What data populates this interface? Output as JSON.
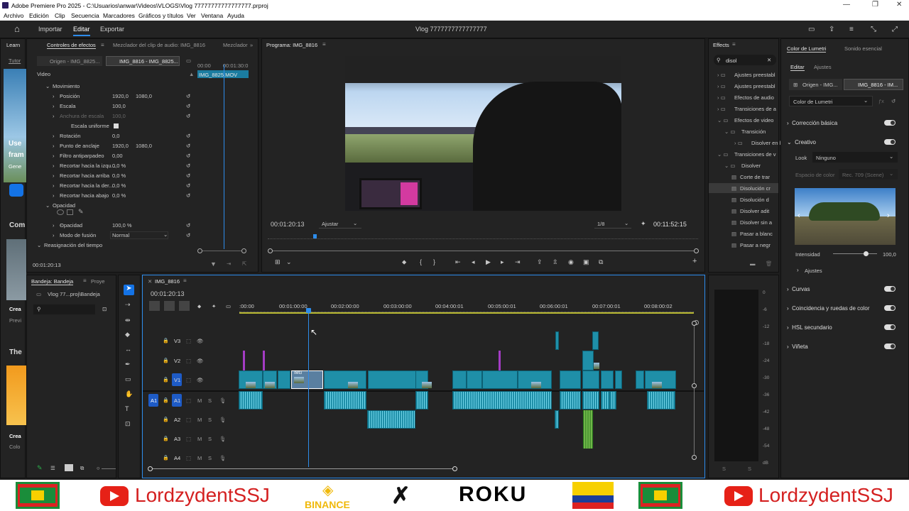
{
  "window": {
    "title": "Adobe Premiere Pro 2025 - C:\\Usuarios\\anwar\\Videos\\VLOGS\\Vlog 77777777777777777.prproj",
    "minimize": "—",
    "maximize": "❐",
    "close": "✕"
  },
  "menu": [
    "Archivo",
    "Edición",
    "Clip",
    "Secuencia",
    "Marcadores",
    "Gráficos y títulos",
    "Ver",
    "Ventana",
    "Ayuda"
  ],
  "topnav": {
    "home": "⌂",
    "import": "Importar",
    "edit": "Editar",
    "export": "Exportar",
    "project_title": "Vlog 7777777777777777"
  },
  "learn": {
    "tab": "Learn",
    "tutor": "Tutor",
    "use": "Use",
    "fram": "fram",
    "gene": "Gene",
    "com": "Com",
    "crea": "Crea",
    "previ": "Previ",
    "the": "The",
    "crea2": "Crea",
    "colo": "Colo"
  },
  "effect_controls": {
    "tabs": [
      "Controles de efectos",
      "Mezclador del clip de audio: IMG_8816",
      "Mezclador"
    ],
    "source_tab": "Origen - IMG_8825...",
    "seq_tab": "IMG_8816 - IMG_8825...",
    "ruler": [
      "00:00",
      "00:01:30:0"
    ],
    "clip_name": "IMG_8825.MOV",
    "video_label": "Video",
    "rows": [
      {
        "name": "Movimiento",
        "v1": "",
        "v2": ""
      },
      {
        "name": "Posición",
        "v1": "1920,0",
        "v2": "1080,0"
      },
      {
        "name": "Escala",
        "v1": "100,0",
        "v2": ""
      },
      {
        "name": "Anchura de escala",
        "v1": "100,0",
        "v2": ""
      },
      {
        "name": "Escala uniforme",
        "v1": "",
        "v2": ""
      },
      {
        "name": "Rotación",
        "v1": "0,0",
        "v2": ""
      },
      {
        "name": "Punto de anclaje",
        "v1": "1920,0",
        "v2": "1080,0"
      },
      {
        "name": "Filtro antiparpadeo",
        "v1": "0,00",
        "v2": ""
      },
      {
        "name": "Recortar hacia la izqu...",
        "v1": "0,0 %",
        "v2": ""
      },
      {
        "name": "Recortar hacia arriba",
        "v1": "0,0 %",
        "v2": ""
      },
      {
        "name": "Recortar hacia la der...",
        "v1": "0,0 %",
        "v2": ""
      },
      {
        "name": "Recortar hacia abajo",
        "v1": "0,0 %",
        "v2": ""
      },
      {
        "name": "Opacidad",
        "v1": "",
        "v2": ""
      },
      {
        "name": "Opacidad",
        "v1": "100,0 %",
        "v2": ""
      },
      {
        "name": "Modo de fusión",
        "v1": "Normal",
        "v2": ""
      },
      {
        "name": "Reasignación del tiempo",
        "v1": "",
        "v2": ""
      }
    ],
    "timecode": "00:01:20:13"
  },
  "program": {
    "tab": "Programa: IMG_8816",
    "timecode": "00:01:20:13",
    "fit": "Ajustar",
    "quality": "1/8",
    "duration": "00:11:52:15"
  },
  "effects": {
    "tab": "Effects",
    "search": "disol",
    "items": [
      "Ajustes preestabl",
      "Ajustes preestabl",
      "Efectos de audio",
      "Transiciones de a",
      "Efectos de video",
      "Transición",
      "Disolver en b",
      "Transiciones de v",
      "Disolver",
      "Corte de trar",
      "Disolución cr",
      "Disolución d",
      "Disolver adit",
      "Disolver sin a",
      "Pasar a blanc",
      "Pasar a negr"
    ]
  },
  "lumetri": {
    "tab1": "Color de Lumetri",
    "tab2": "Sonido esencial",
    "edit": "Editar",
    "settings": "Ajustes",
    "src": "Origen - IMG...",
    "seq": "IMG_8816 - IM...",
    "effect_select": "Color de Lumetri",
    "sections": [
      "Corrección básica",
      "Creativo",
      "Curvas",
      "Coincidencia y ruedas de color",
      "HSL secundario",
      "Viñeta"
    ],
    "look_label": "Look",
    "look_value": "Ninguno",
    "space_label": "Espacio de color",
    "space_value": "Rec. 709 (Scene)",
    "intensity_label": "Intensidad",
    "intensity_value": "100,0",
    "adjust_label": "Ajustes"
  },
  "project": {
    "tab1": "Bandeja: Bandeja",
    "tab2": "Proye",
    "path": "Vlog 77...proj\\Bandeja"
  },
  "timeline": {
    "tab": "IMG_8816",
    "timecode": "00:01:20:13",
    "ruler": [
      ":00:00",
      "00:01:00:00",
      "00:02:00:00",
      "00:03:00:00",
      "00:04:00:01",
      "00:05:00:01",
      "00:06:00:01",
      "00:07:00:01",
      "00:08:00:02"
    ],
    "tracks": [
      "V3",
      "V2",
      "V1",
      "A1",
      "A2",
      "A3",
      "A4"
    ],
    "clip_label": "IMG"
  },
  "meter": {
    "scale": [
      "0",
      "-6",
      "-12",
      "-18",
      "-24",
      "-30",
      "-36",
      "-42",
      "-48",
      "-54",
      "dB"
    ],
    "solo": "S"
  },
  "banner": {
    "text1": "LordzydentSSJ",
    "binance": "BINANCE",
    "roku": "ROKU",
    "text2": "LordzydentSSJ"
  },
  "colors": {
    "accent": "#2d8ceb",
    "clip": "#1f8fa8",
    "flag_green": "#1a8d3a",
    "flag_red": "#d22",
    "flag_yellow": "#f7d000",
    "youtube": "#e62117"
  }
}
